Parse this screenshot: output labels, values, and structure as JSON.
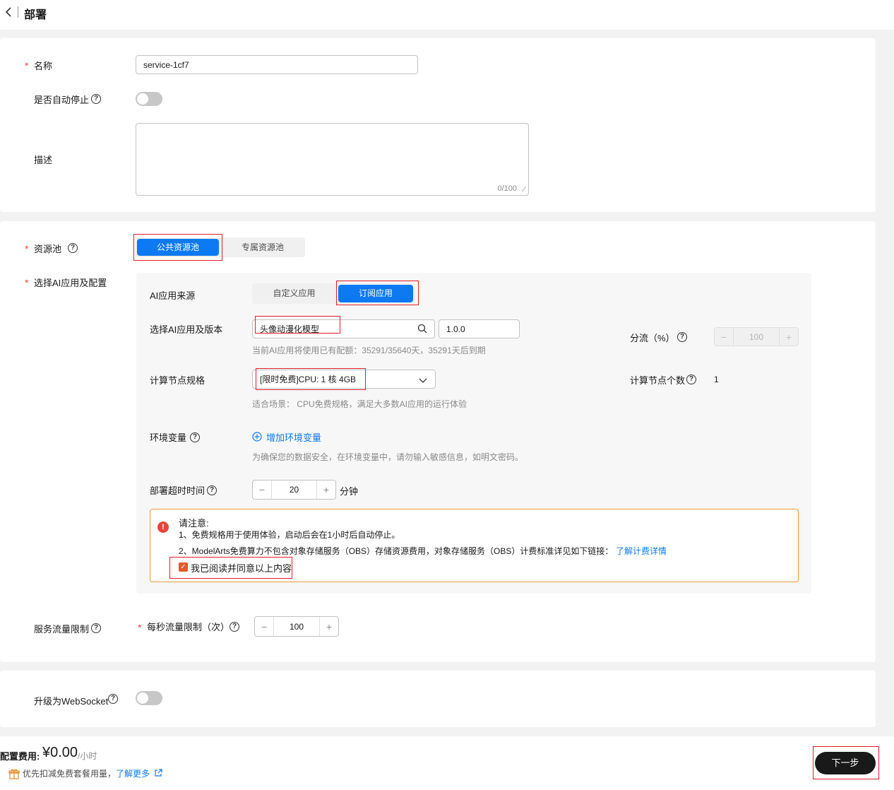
{
  "header": {
    "title": "部署",
    "back_icon": "chevron-left-icon"
  },
  "basic": {
    "name_label": "名称",
    "name_value": "service-1cf7",
    "auto_stop_label": "是否自动停止",
    "desc_label": "描述",
    "desc_counter": "0/100"
  },
  "resource": {
    "pool_label": "资源池",
    "pool_options": [
      "公共资源池",
      "专属资源池"
    ],
    "pool_selected": "公共资源池",
    "app_config_label": "选择AI应用及配置",
    "app_source_label": "AI应用来源",
    "app_source_options": [
      "自定义应用",
      "订阅应用"
    ],
    "app_source_selected": "订阅应用",
    "app_version_label": "选择AI应用及版本",
    "app_value": "头像动漫化模型",
    "version_value": "1.0.0",
    "quota_hint": "当前AI应用将使用已有配额：35291/35640天，35291天后到期",
    "split_label": "分流（%）",
    "split_value": "100",
    "spec_label": "计算节点规格",
    "spec_value": "[限时免费]CPU: 1 核 4GB",
    "spec_hint": "适合场景： CPU免费规格，满足大多数AI应用的运行体验",
    "node_count_label": "计算节点个数",
    "node_count_value": "1",
    "env_label": "环境变量",
    "env_add_label": "增加环境变量",
    "env_hint": "为确保您的数据安全，在环境变量中，请勿输入敏感信息，如明文密码。",
    "timeout_label": "部署超时时间",
    "timeout_value": "20",
    "timeout_unit": "分钟"
  },
  "notice": {
    "title": "请注意:",
    "line1": "1、免费规格用于使用体验，启动后会在1小时后自动停止。",
    "line2": "2、ModelArts免费算力不包含对象存储服务（OBS）存储资源费用，对象存储服务（OBS）计费标准详见如下链接：",
    "line2_link": "了解计费详情",
    "agree_label": "我已阅读并同意以上内容",
    "agree_checked": true
  },
  "traffic": {
    "label": "服务流量限制",
    "qps_label": "每秒流量限制（次）",
    "qps_value": "100"
  },
  "websocket": {
    "label": "升级为WebSocket"
  },
  "footer": {
    "cost_label": "配置费用:",
    "cost_value": "¥0.00",
    "cost_unit": "/小时",
    "promo_text": "优先扣减免费套餐用量，",
    "promo_link": "了解更多",
    "next_label": "下一步"
  },
  "colors": {
    "primary": "#0d79f2",
    "required": "#e7463d",
    "highlight": "#e01e2a",
    "warning_border": "#ed9b3a"
  }
}
